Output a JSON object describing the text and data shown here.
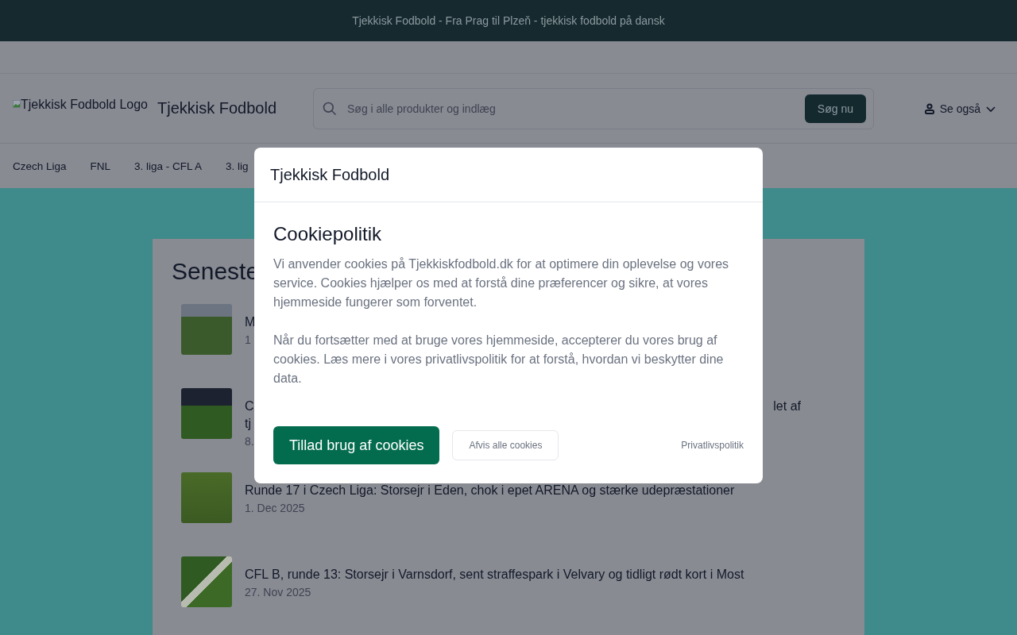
{
  "top_banner": {
    "text": "Tjekkisk Fodbold - Fra Prag til Plzeň - tjekkisk fodbold på dansk"
  },
  "header": {
    "logo_alt": "Tjekkisk Fodbold Logo",
    "site_title": "Tjekkisk Fodbold",
    "search": {
      "placeholder": "Søg i alle produkter og indlæg",
      "button": "Søg nu"
    },
    "menu": {
      "label": "Se også"
    }
  },
  "nav": [
    {
      "label": "Czech Liga"
    },
    {
      "label": "FNL"
    },
    {
      "label": "3. liga - CFL A"
    },
    {
      "label": "3. lig"
    }
  ],
  "latest": {
    "title": "Seneste",
    "articles": [
      {
        "title": "M",
        "date": "1"
      },
      {
        "title": "C",
        "title_end": "let af",
        "title_line2": "tj",
        "date": "8."
      },
      {
        "title": "Runde 17 i Czech Liga: Storsejr i Eden, chok i epet ARENA og stærke udepræstationer",
        "date": "1. Dec 2025"
      },
      {
        "title": "CFL B, runde 13: Storsejr i Varnsdorf, sent straffespark i Velvary og tidligt rødt kort i Most",
        "date": "27. Nov 2025"
      }
    ]
  },
  "cookie_dialog": {
    "site_name": "Tjekkisk Fodbold",
    "heading": "Cookiepolitik",
    "paragraphs": [
      "Vi anvender cookies på Tjekkiskfodbold.dk for at optimere din oplevelse og vores service. Cookies hjælper os med at forstå dine præferencer og sikre, at vores hjemmeside fungerer som forventet.",
      "Når du fortsætter med at bruge vores hjemmeside, accepterer du vores brug af cookies. Læs mere i vores privatlivspolitik for at forstå, hvordan vi beskytter dine data."
    ],
    "accept_button": "Tillad brug af cookies",
    "reject_button": "Afvis alle cookies",
    "policy_link": "Privatlivspolitik"
  }
}
